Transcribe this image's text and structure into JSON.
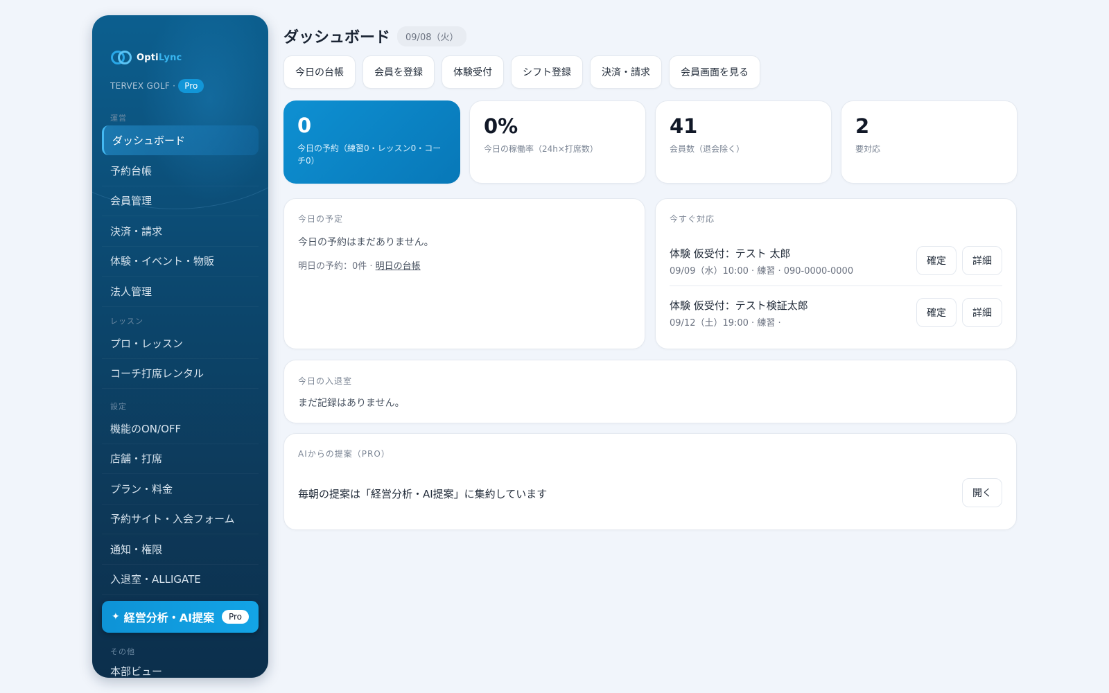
{
  "brand": {
    "logo_prefix": "Opti",
    "logo_suffix": "Lync",
    "org": "TERVEX GOLF ·",
    "plan_badge": "Pro",
    "accent": "#0e93d6"
  },
  "sidebar": {
    "sections": [
      {
        "label": "運営",
        "items": [
          {
            "label": "ダッシュボード",
            "active": true
          },
          {
            "label": "予約台帳"
          },
          {
            "label": "会員管理"
          },
          {
            "label": "決済・請求"
          },
          {
            "label": "体験・イベント・物販"
          },
          {
            "label": "法人管理"
          }
        ]
      },
      {
        "label": "レッスン",
        "items": [
          {
            "label": "プロ・レッスン"
          },
          {
            "label": "コーチ打席レンタル"
          }
        ]
      },
      {
        "label": "設定",
        "items": [
          {
            "label": "機能のON/OFF"
          },
          {
            "label": "店舗・打席"
          },
          {
            "label": "プラン・料金"
          },
          {
            "label": "予約サイト・入会フォーム"
          },
          {
            "label": "通知・権限"
          },
          {
            "label": "入退室・ALLIGATE"
          }
        ]
      }
    ],
    "cta": {
      "icon": "✦",
      "label": "経営分析・AI提案",
      "badge": "Pro"
    },
    "other_section": "その他",
    "other_item": "本部ビュー"
  },
  "header": {
    "title": "ダッシュボード",
    "date": "09/08（火）"
  },
  "quick_actions": [
    "今日の台帳",
    "会員を登録",
    "体験受付",
    "シフト登録",
    "決済・請求",
    "会員画面を見る"
  ],
  "stats": [
    {
      "value": "0",
      "label": "今日の予約（練習0・レッスン0・コーチ0）"
    },
    {
      "value": "0%",
      "label": "今日の稼働率（24h×打席数）"
    },
    {
      "value": "41",
      "label": "会員数（退会除く）"
    },
    {
      "value": "2",
      "label": "要対応"
    }
  ],
  "schedule": {
    "title": "今日の予定",
    "empty": "今日の予約はまだありません。",
    "tomorrow_prefix": "明日の予約：0件 · ",
    "tomorrow_link": "明日の台帳"
  },
  "urgent": {
    "title": "今すぐ対応",
    "tasks": [
      {
        "title": "体験 仮受付：テスト 太郎",
        "detail": "09/09（水）10:00 · 練習 · 090-0000-0000",
        "confirm": "確定",
        "details": "詳細"
      },
      {
        "title": "体験 仮受付：テスト検証太郎",
        "detail": "09/12（土）19:00 · 練習 ·",
        "confirm": "確定",
        "details": "詳細"
      }
    ]
  },
  "checkin": {
    "title": "今日の入退室",
    "empty": "まだ記録はありません。"
  },
  "ai": {
    "title": "AIからの提案（PRO）",
    "message": "毎朝の提案は「経営分析・AI提案」に集約しています",
    "open": "開く"
  }
}
